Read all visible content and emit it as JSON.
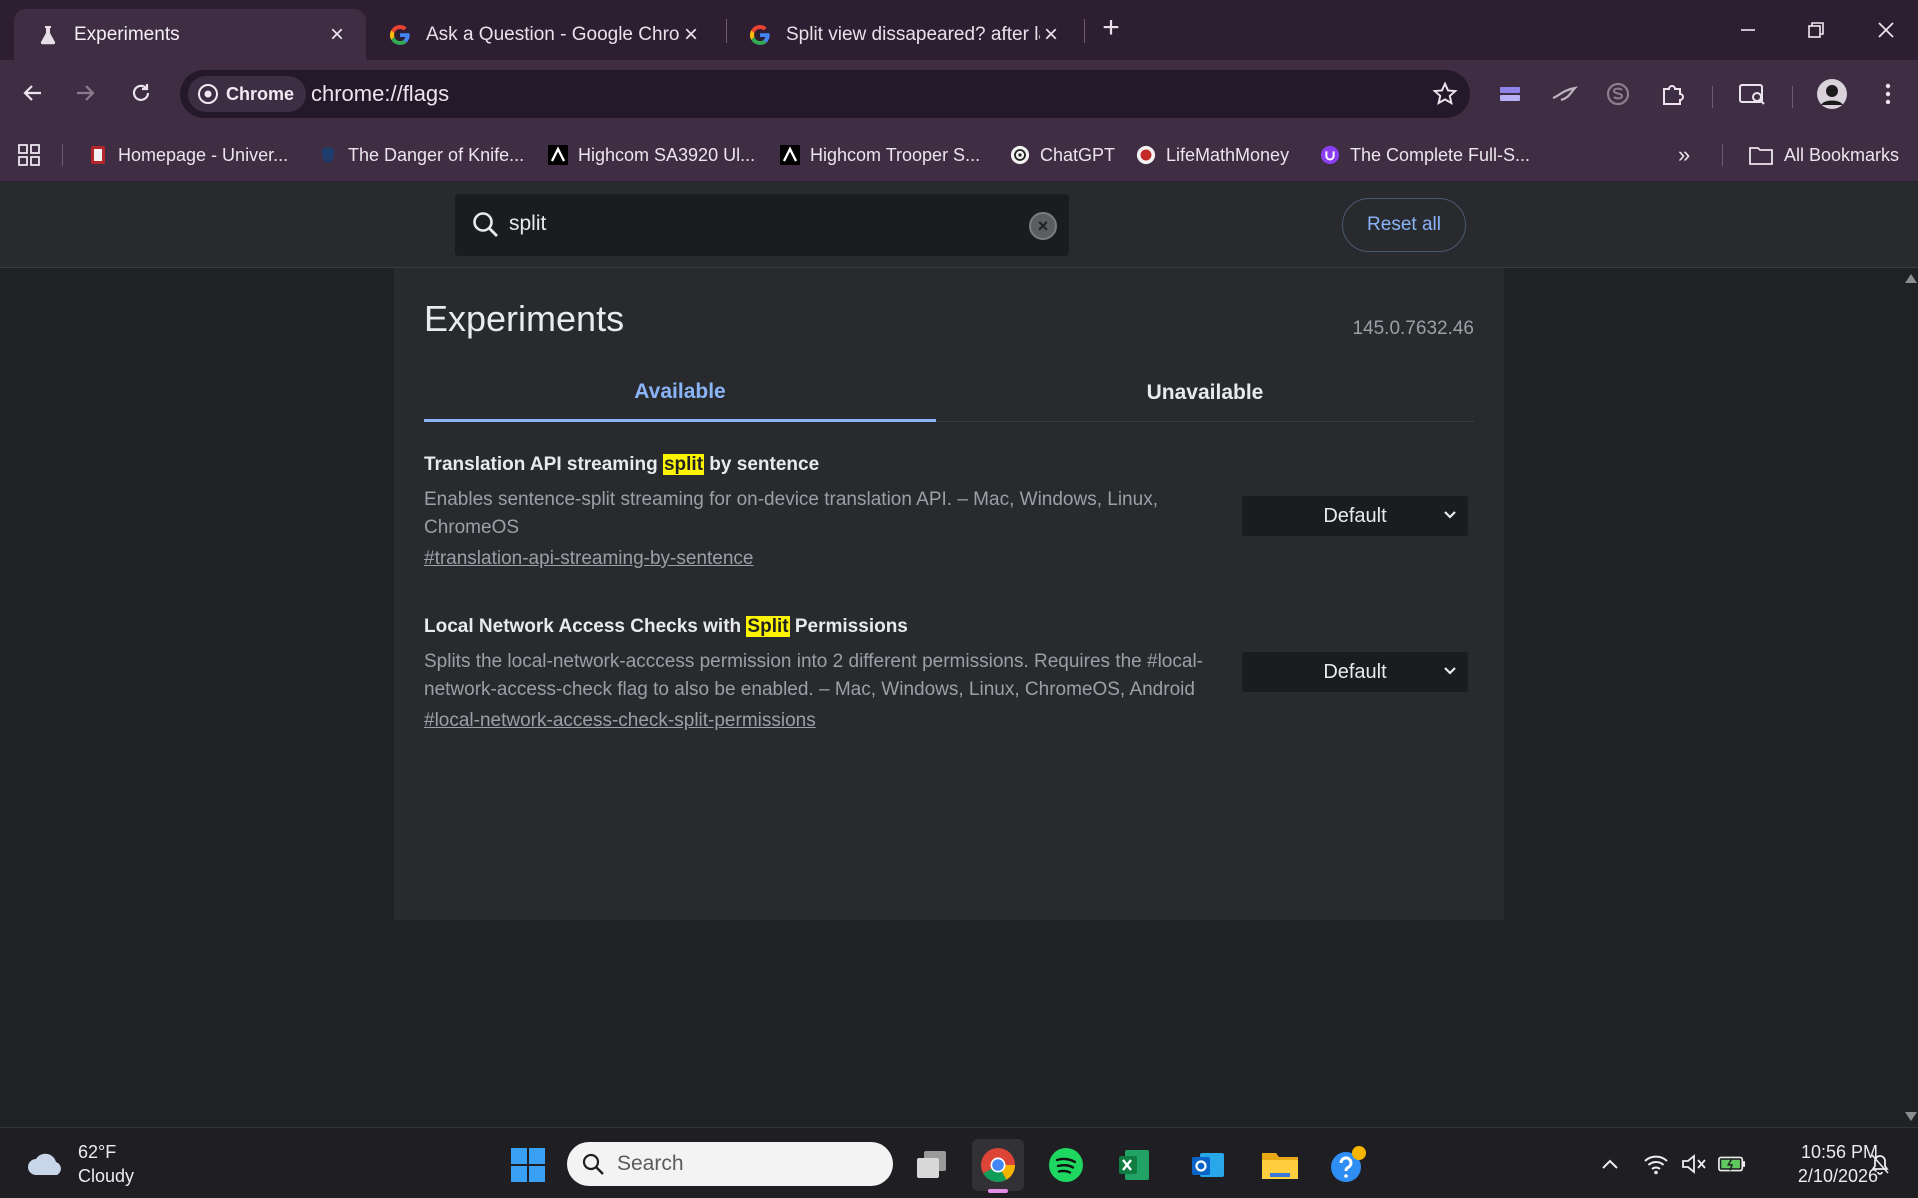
{
  "tabs": [
    {
      "title": "Experiments",
      "icon": "flask-icon",
      "active": true
    },
    {
      "title": "Ask a Question - Google Chrom",
      "icon": "google-icon",
      "active": false
    },
    {
      "title": "Split view dissapeared? after lat",
      "icon": "google-icon",
      "active": false
    }
  ],
  "toolbar": {
    "site_chip": "Chrome",
    "url": "chrome://flags"
  },
  "bookmarks": {
    "items": [
      {
        "label": "Homepage - Univer...",
        "icon": "university-icon"
      },
      {
        "label": "The Danger of Knife...",
        "icon": "shield-icon"
      },
      {
        "label": "Highcom SA3920 Ul...",
        "icon": "highcom-icon"
      },
      {
        "label": "Highcom Trooper S...",
        "icon": "highcom-icon"
      },
      {
        "label": "ChatGPT",
        "icon": "chatgpt-icon"
      },
      {
        "label": "LifeMathMoney",
        "icon": "lifemathmoney-icon"
      },
      {
        "label": "The Complete Full-S...",
        "icon": "udemy-icon"
      }
    ],
    "all_bookmarks": "All Bookmarks"
  },
  "flags": {
    "search_value": "split",
    "reset_label": "Reset all",
    "heading": "Experiments",
    "version": "145.0.7632.46",
    "tab_available": "Available",
    "tab_unavailable": "Unavailable",
    "experiments": [
      {
        "title_pre": "Translation API streaming ",
        "title_hl": "split",
        "title_post": " by sentence",
        "description": "Enables sentence-split streaming for on-device translation API. – Mac, Windows, Linux, ChromeOS",
        "link": "#translation-api-streaming-by-sentence",
        "value": "Default"
      },
      {
        "title_pre": "Local Network Access Checks with ",
        "title_hl": "Split",
        "title_post": " Permissions",
        "description": "Splits the local-network-acccess permission into 2 different permissions. Requires the #local-network-access-check flag to also be enabled. – Mac, Windows, Linux, ChromeOS, Android",
        "link": "#local-network-access-check-split-permissions",
        "value": "Default"
      }
    ]
  },
  "taskbar": {
    "temperature": "62°F",
    "condition": "Cloudy",
    "search_label": "Search",
    "time": "10:56 PM",
    "date": "2/10/2026"
  },
  "colors": {
    "frame": "#2d1f31",
    "toolbar": "#3f2d44",
    "page_bg": "#202124",
    "accent": "#8ab4f8",
    "highlight": "#fcf401"
  }
}
